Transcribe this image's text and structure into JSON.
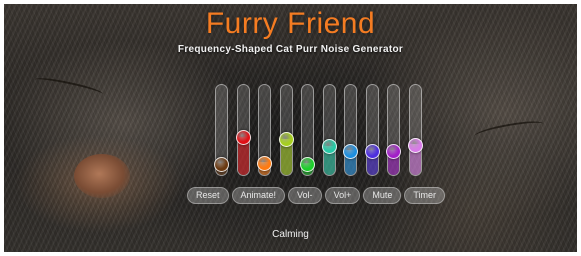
{
  "app": {
    "title": "Furry Friend",
    "subtitle": "Frequency-Shaped Cat Purr Noise Generator"
  },
  "sliders": [
    {
      "id": "band-1",
      "color": "#6b3a12",
      "level": 0.05
    },
    {
      "id": "band-2",
      "color": "#e01016",
      "level": 0.4
    },
    {
      "id": "band-3",
      "color": "#ff7a10",
      "level": 0.06
    },
    {
      "id": "band-4",
      "color": "#a6cf1e",
      "level": 0.37
    },
    {
      "id": "band-5",
      "color": "#1ccf2a",
      "level": 0.05
    },
    {
      "id": "band-6",
      "color": "#27c9a6",
      "level": 0.28
    },
    {
      "id": "band-7",
      "color": "#1d8fe0",
      "level": 0.22
    },
    {
      "id": "band-8",
      "color": "#4d2ee0",
      "level": 0.22
    },
    {
      "id": "band-9",
      "color": "#a21fc8",
      "level": 0.22
    },
    {
      "id": "band-10",
      "color": "#d87ae8",
      "level": 0.3
    }
  ],
  "buttons": [
    {
      "id": "reset",
      "label": "Reset"
    },
    {
      "id": "animate",
      "label": "Animate!"
    },
    {
      "id": "vol-down",
      "label": "Vol-"
    },
    {
      "id": "vol-up",
      "label": "Vol+"
    },
    {
      "id": "mute",
      "label": "Mute"
    },
    {
      "id": "timer",
      "label": "Timer"
    }
  ],
  "status": "Calming"
}
